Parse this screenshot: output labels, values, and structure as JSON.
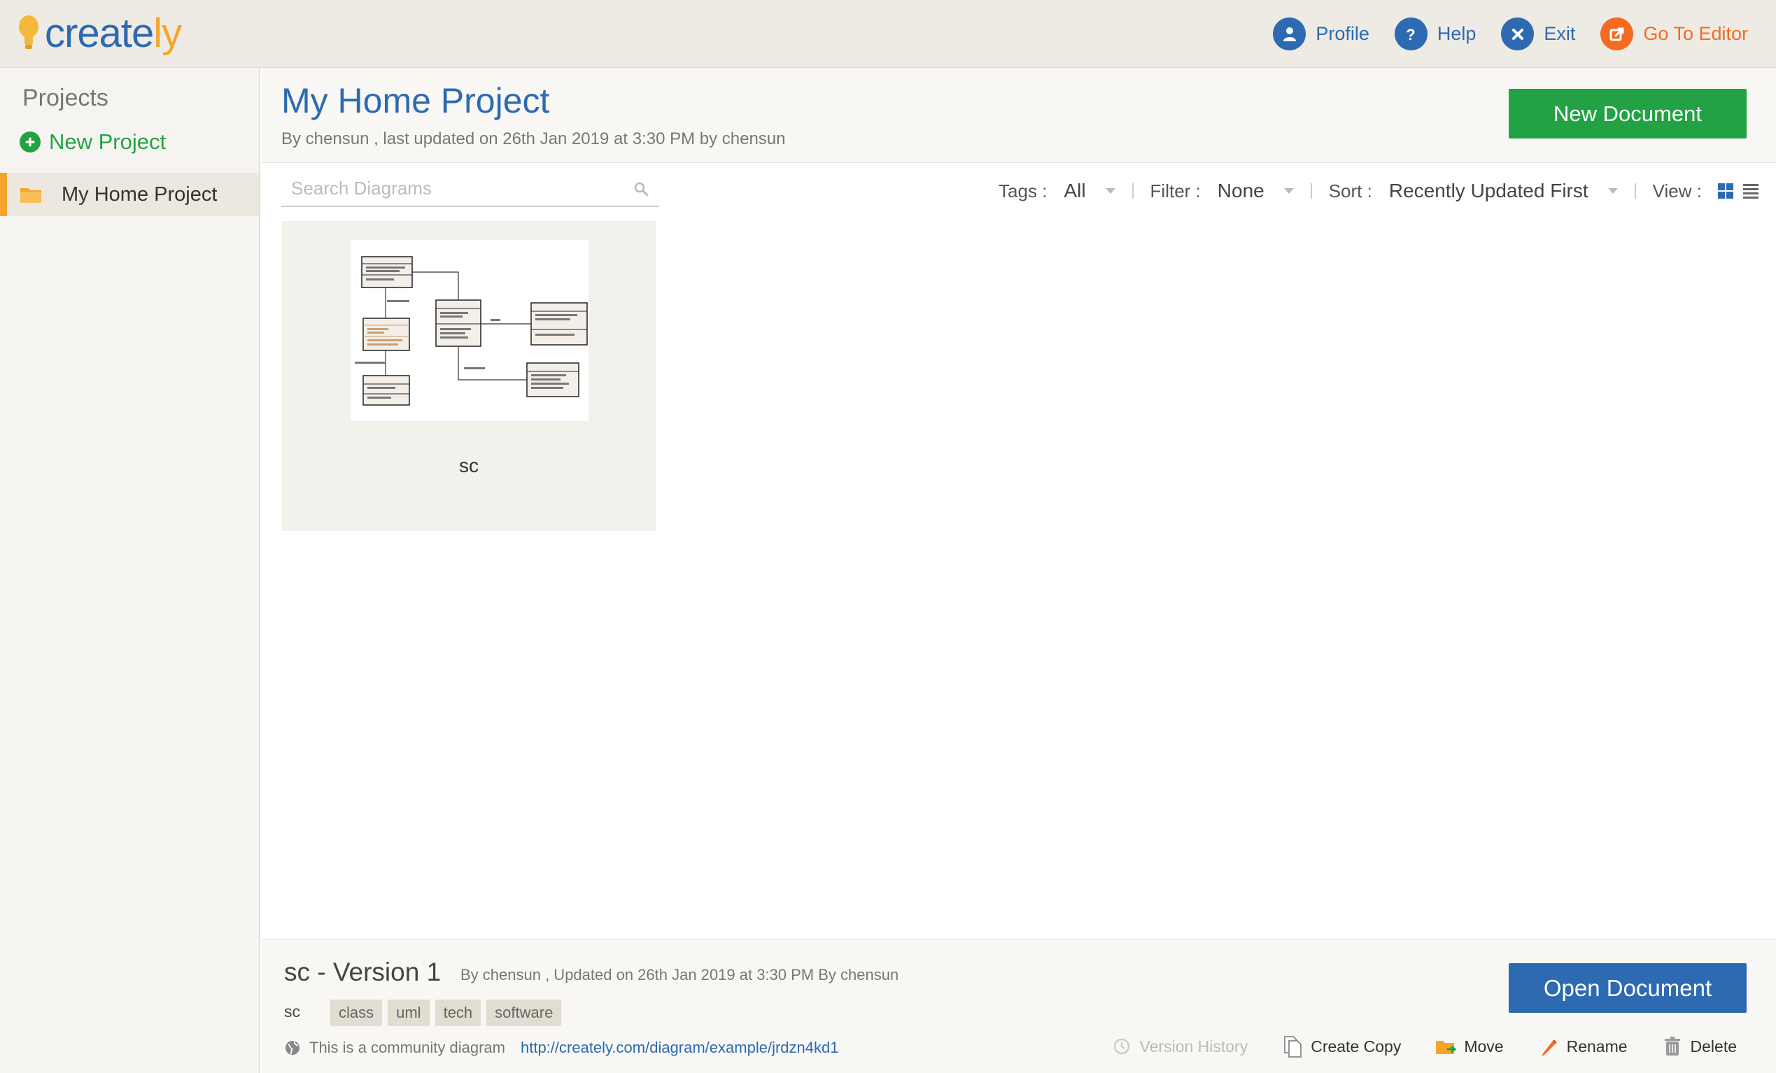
{
  "app": {
    "logo_text_blue": "create",
    "logo_text_orange": "ly",
    "colors": {
      "brand_blue": "#2d6ab2",
      "brand_orange": "#f4a52a",
      "green": "#22a244",
      "accent_orange": "#f26b21"
    }
  },
  "topnav": {
    "profile_label": "Profile",
    "help_label": "Help",
    "exit_label": "Exit",
    "editor_label": "Go To Editor"
  },
  "sidebar": {
    "title": "Projects",
    "new_project_label": "New Project",
    "items": [
      {
        "label": "My Home Project",
        "icon": "folder-icon",
        "selected": true
      }
    ]
  },
  "header": {
    "project_title": "My Home Project",
    "subtitle": "By chensun , last updated on 26th Jan 2019 at 3:30 PM by chensun",
    "new_document_label": "New Document"
  },
  "search": {
    "placeholder": "Search Diagrams",
    "value": ""
  },
  "toolbar": {
    "tags_label": "Tags :",
    "tags_value": "All",
    "filter_label": "Filter :",
    "filter_value": "None",
    "sort_label": "Sort :",
    "sort_value": "Recently Updated First",
    "view_label": "View :",
    "view_mode": "grid"
  },
  "documents": [
    {
      "name": "sc",
      "thumbnail": "uml-class-diagram"
    }
  ],
  "footer": {
    "title": "sc - Version 1",
    "meta": "By chensun , Updated on 26th Jan 2019 at 3:30 PM By chensun",
    "doc_name": "sc",
    "tags": [
      "class",
      "uml",
      "tech",
      "software"
    ],
    "community_text": "This is a community diagram",
    "community_link": "http://creately.com/diagram/example/jrdzn4kd1",
    "open_document_label": "Open Document",
    "actions": {
      "version_history": "Version History",
      "create_copy": "Create Copy",
      "move": "Move",
      "rename": "Rename",
      "delete": "Delete"
    }
  }
}
